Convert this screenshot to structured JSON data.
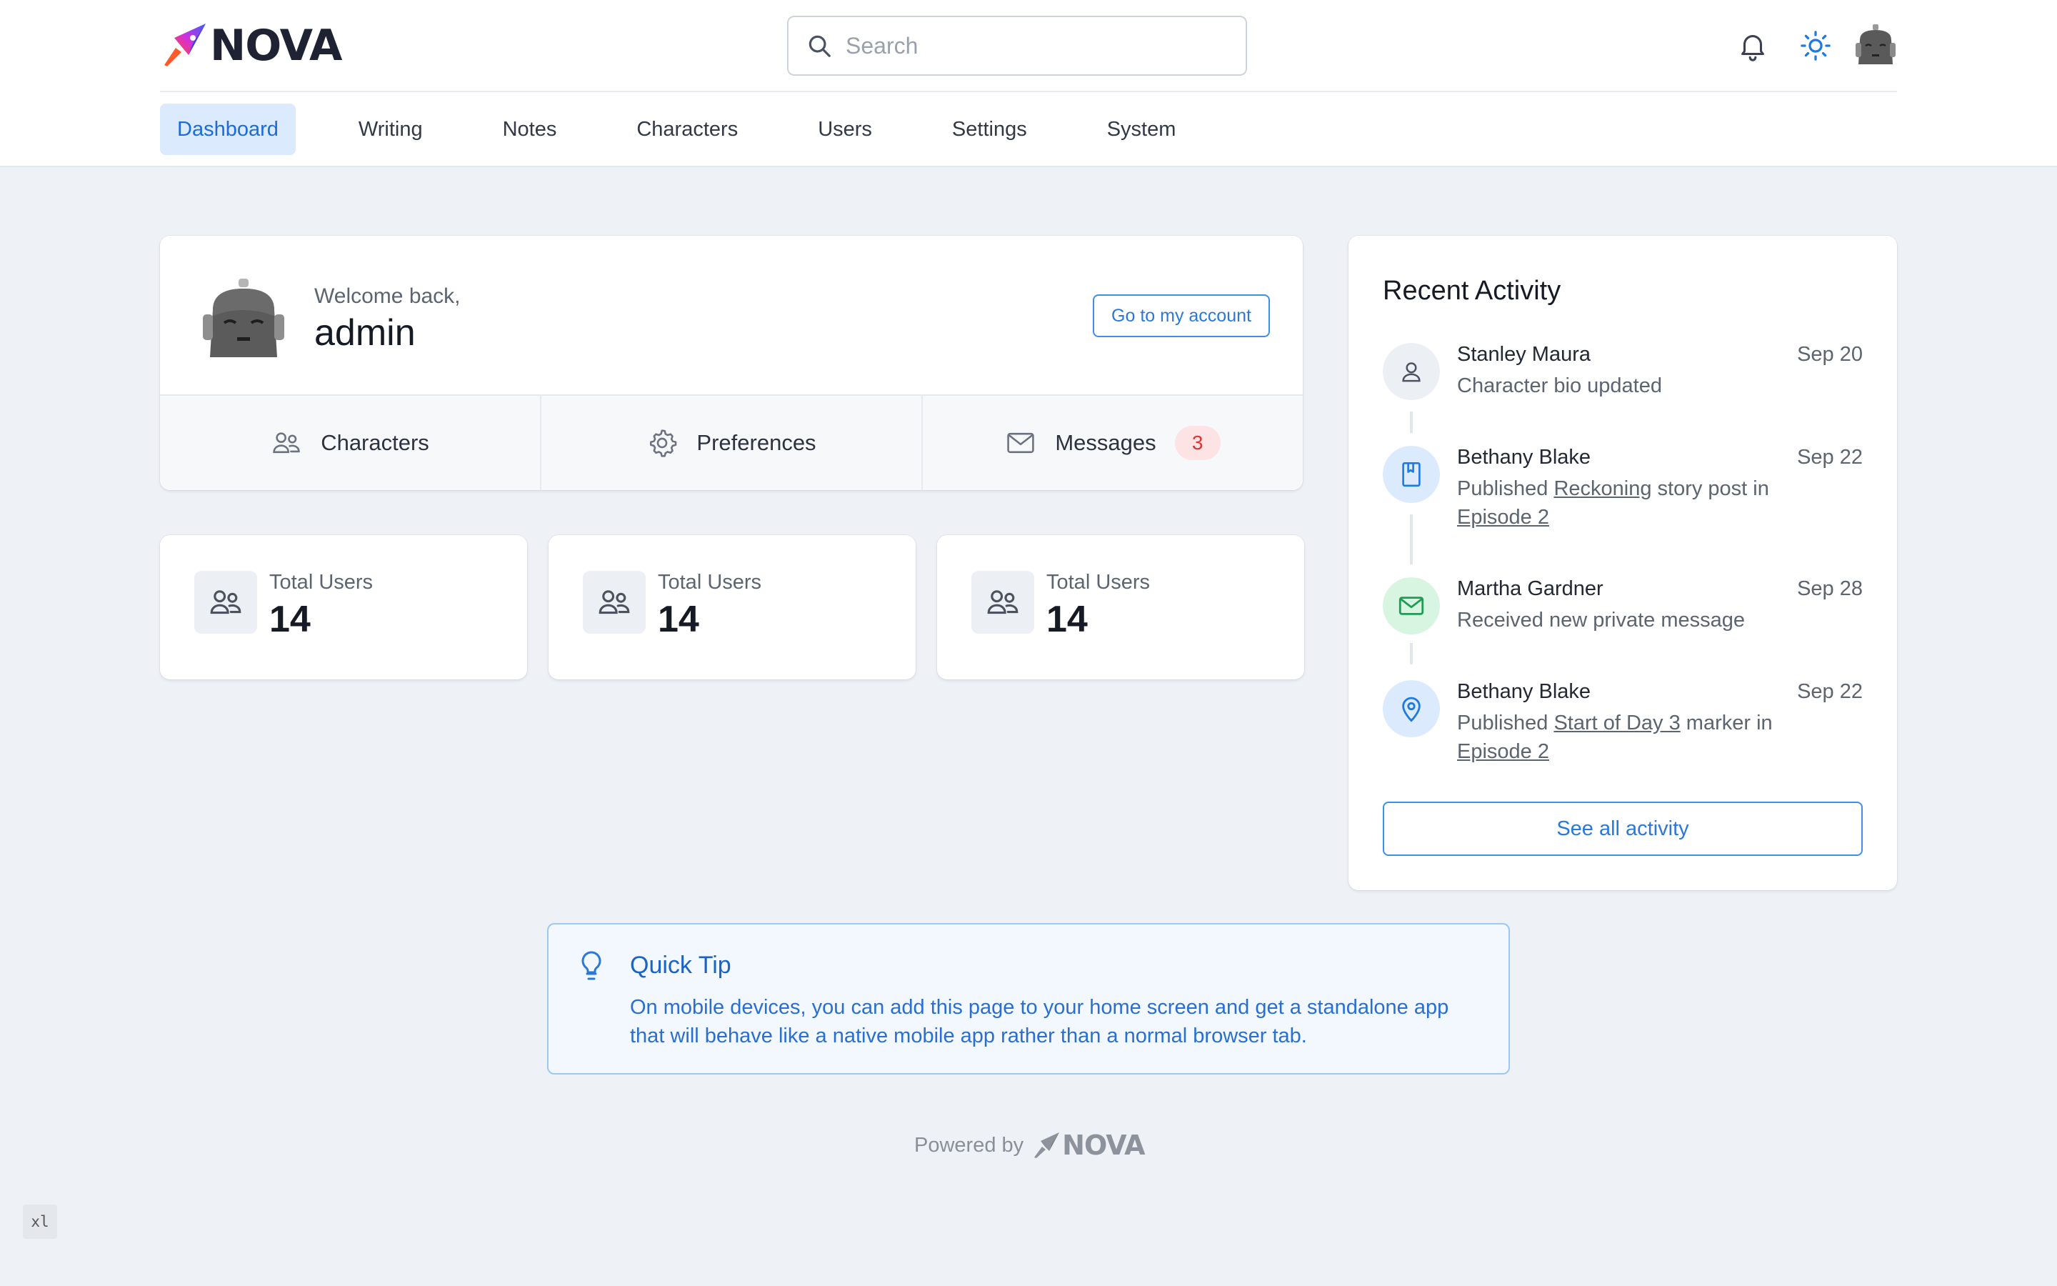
{
  "brand": {
    "name": "NOVA"
  },
  "search": {
    "placeholder": "Search",
    "value": ""
  },
  "header": {
    "icons": [
      "bell-icon",
      "sun-icon",
      "user-avatar"
    ]
  },
  "nav": {
    "items": [
      {
        "label": "Dashboard",
        "active": true
      },
      {
        "label": "Writing"
      },
      {
        "label": "Notes"
      },
      {
        "label": "Characters"
      },
      {
        "label": "Users"
      },
      {
        "label": "Settings"
      },
      {
        "label": "System"
      }
    ]
  },
  "welcome": {
    "greeting": "Welcome back,",
    "username": "admin",
    "account_button": "Go to my account",
    "links": [
      {
        "label": "Characters",
        "icon": "users-icon"
      },
      {
        "label": "Preferences",
        "icon": "gear-icon"
      },
      {
        "label": "Messages",
        "icon": "mail-icon",
        "badge": "3"
      }
    ]
  },
  "stats": [
    {
      "label": "Total Users",
      "value": "14",
      "icon": "users-icon"
    },
    {
      "label": "Total Users",
      "value": "14",
      "icon": "users-icon"
    },
    {
      "label": "Total Users",
      "value": "14",
      "icon": "users-icon"
    }
  ],
  "activity": {
    "title": "Recent Activity",
    "items": [
      {
        "name": "Stanley Maura",
        "date": "Sep 20",
        "text": "Character bio updated",
        "icon": "user-icon"
      },
      {
        "name": "Bethany Blake",
        "date": "Sep 22",
        "pre": "Published ",
        "link1": "Reckoning",
        "mid": " story post in ",
        "link2": "Episode 2",
        "icon": "book-icon"
      },
      {
        "name": "Martha Gardner",
        "date": "Sep 28",
        "text": "Received new private message",
        "icon": "mail-icon"
      },
      {
        "name": "Bethany Blake",
        "date": "Sep 22",
        "pre": "Published ",
        "link1": "Start of Day 3",
        "mid": " marker in ",
        "link2": "Episode 2",
        "icon": "map-pin-icon"
      }
    ],
    "see_all": "See all activity"
  },
  "tip": {
    "title": "Quick Tip",
    "text": "On mobile devices, you can add this page to your home screen and get a standalone app that will behave like a native mobile app rather than a normal browser tab."
  },
  "footer": {
    "powered_by": "Powered by",
    "brand": "NOVA"
  },
  "breakpoint": "xl",
  "colors": {
    "accent": "#1d6bd8",
    "background": "#eef1f6",
    "badge": "#d93636",
    "success": "#1f9d55"
  }
}
